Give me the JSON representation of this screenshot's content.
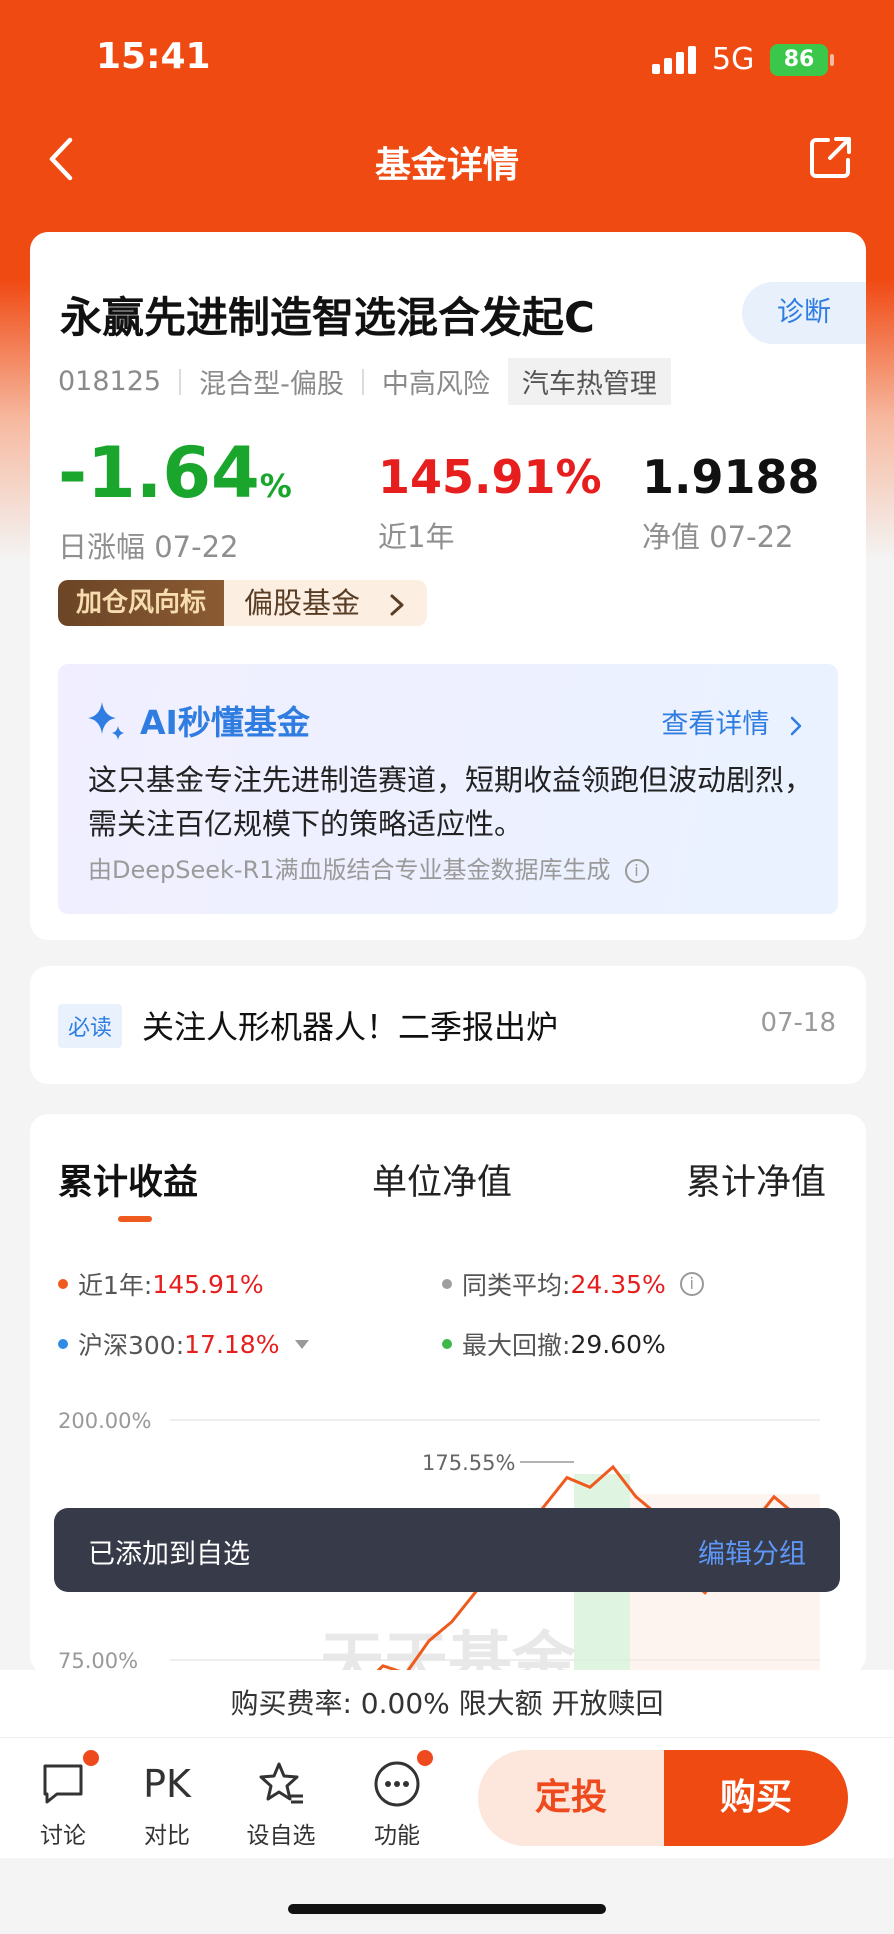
{
  "status": {
    "time": "15:41",
    "network": "5G",
    "battery": "86"
  },
  "nav": {
    "title": "基金详情"
  },
  "fund": {
    "name": "永赢先进制造智选混合发起C",
    "diagnose_label": "诊断",
    "code": "018125",
    "type": "混合型-偏股",
    "risk": "中高风险",
    "tag": "汽车热管理",
    "daily_change": "-1.64",
    "daily_change_unit": "%",
    "daily_change_label": "日涨幅 07-22",
    "year_return": "145.91%",
    "year_return_label": "近1年",
    "nav_value": "1.9188",
    "nav_label": "净值 07-22",
    "banner_badge": "加仓风向标",
    "banner_text": "偏股基金"
  },
  "ai": {
    "title": "AI秒懂基金",
    "more": "查看详情",
    "text": "这只基金专注先进制造赛道，短期收益领跑但波动剧烈，需关注百亿规模下的策略适应性。",
    "footer": "由DeepSeek-R1满血版结合专业基金数据库生成"
  },
  "news": {
    "tag": "必读",
    "title": "关注人形机器人！二季报出炉",
    "date": "07-18"
  },
  "chart": {
    "tabs": [
      "累计收益",
      "单位净值",
      "累计净值"
    ],
    "legend": [
      {
        "label": "近1年:",
        "value": "145.91%",
        "color": "#ef5a1e"
      },
      {
        "label": "同类平均:",
        "value": "24.35%",
        "color": "#9e9e9e"
      },
      {
        "label": "沪深300:",
        "value": "17.18%",
        "color": "#2f8ce6"
      },
      {
        "label": "最大回撤:",
        "value": "29.60%",
        "color": "#3cb84a"
      }
    ],
    "y_ticks": [
      "200.00%",
      "75.00%"
    ],
    "peak_label": "175.55%",
    "watermark": "天天基金"
  },
  "chart_data": {
    "type": "line",
    "title": "",
    "ylim": [
      75,
      200
    ],
    "series": [
      {
        "name": "近1年",
        "values": [
          60,
          72,
          68,
          85,
          95,
          110,
          125,
          140,
          155,
          170,
          165,
          175.55,
          160,
          150,
          120,
          110,
          125,
          145,
          160,
          150,
          145
        ]
      }
    ]
  },
  "toast": {
    "text": "已添加到自选",
    "action": "编辑分组"
  },
  "fee": {
    "text": "购买费率: 0.00% 限大额 开放赎回"
  },
  "bottom": {
    "items": [
      "讨论",
      "对比",
      "设自选",
      "功能"
    ],
    "pk": "PK",
    "sip_label": "定投",
    "buy_label": "购买"
  }
}
